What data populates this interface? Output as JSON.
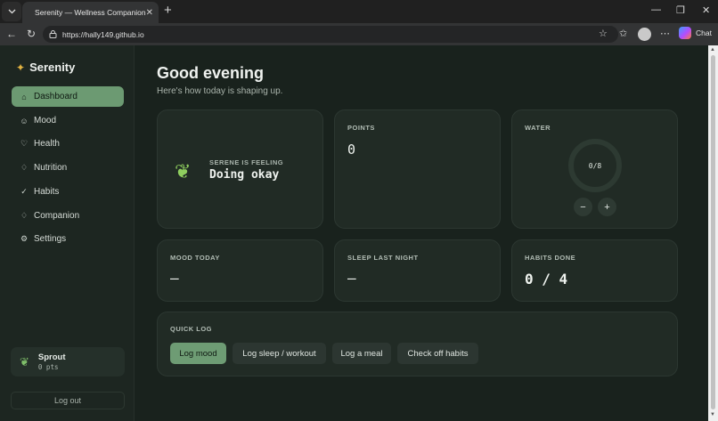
{
  "browser": {
    "tab_title": "Serenity — Wellness Companion",
    "url": "https://hally149.github.io",
    "chat_label": "Chat"
  },
  "sidebar": {
    "brand": "Serenity",
    "items": [
      {
        "label": "Dashboard",
        "icon": "home-icon",
        "glyph": "⌂",
        "active": true
      },
      {
        "label": "Mood",
        "icon": "smile-icon",
        "glyph": "☺",
        "active": false
      },
      {
        "label": "Health",
        "icon": "heart-icon",
        "glyph": "♡",
        "active": false
      },
      {
        "label": "Nutrition",
        "icon": "flame-icon",
        "glyph": "♢",
        "active": false
      },
      {
        "label": "Habits",
        "icon": "check-circle-icon",
        "glyph": "✓",
        "active": false
      },
      {
        "label": "Companion",
        "icon": "drop-icon",
        "glyph": "♢",
        "active": false
      },
      {
        "label": "Settings",
        "icon": "gear-icon",
        "glyph": "⚙",
        "active": false
      }
    ],
    "user": {
      "name": "Sprout",
      "points": "0 pts"
    },
    "logout_label": "Log out"
  },
  "main": {
    "greeting": "Good evening",
    "subtitle": "Here's how today is shaping up.",
    "feeling": {
      "label": "SERENE IS FEELING",
      "value": "Doing okay"
    },
    "points": {
      "label": "POINTS",
      "value": "0"
    },
    "water": {
      "label": "WATER",
      "count": "0/8",
      "decrement": "−",
      "increment": "+"
    },
    "mood": {
      "label": "MOOD TODAY",
      "value": "—"
    },
    "sleep": {
      "label": "SLEEP LAST NIGHT",
      "value": "—"
    },
    "habits": {
      "label": "HABITS DONE",
      "value": "0 / 4"
    },
    "quick_log": {
      "label": "QUICK LOG",
      "buttons": [
        "Log mood",
        "Log sleep / workout",
        "Log a meal",
        "Check off habits"
      ]
    }
  },
  "colors": {
    "accent": "#6c9a72",
    "background": "#19221d",
    "card": "#212b25"
  }
}
